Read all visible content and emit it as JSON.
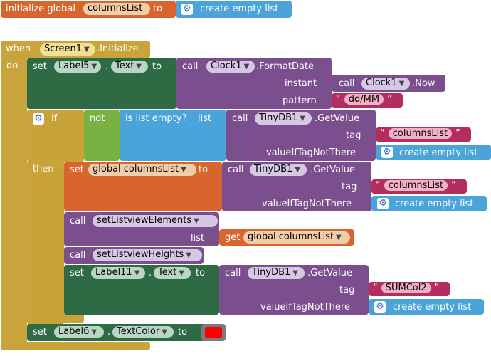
{
  "init_global": {
    "keyword": "initialize global",
    "var_name": "columnsList",
    "to": "to",
    "value_block": "create empty list"
  },
  "event": {
    "when": "when",
    "component": "Screen1",
    "event_name": ".Initialize",
    "do": "do"
  },
  "set_label5": {
    "set": "set",
    "component": "Label5",
    "dot": ".",
    "property": "Text",
    "to": "to",
    "call": "call",
    "clock_component": "Clock1",
    "method": ".FormatDate",
    "instant_label": "instant",
    "instant_call": "call",
    "instant_component": "Clock1",
    "instant_method": ".Now",
    "pattern_label": "pattern",
    "pattern_value": "dd/MM"
  },
  "if_block": {
    "if": "if",
    "not": "not",
    "is_list_empty": "is list empty?",
    "list_label": "list",
    "call": "call",
    "db_component": "TinyDB1",
    "method": ".GetValue",
    "tag_label": "tag",
    "tag_value": "columnsList",
    "default_label": "valueIfTagNotThere",
    "default_value": "create empty list",
    "then": "then"
  },
  "set_global": {
    "set": "set",
    "var_name": "global columnsList",
    "to": "to",
    "call": "call",
    "db_component": "TinyDB1",
    "method": ".GetValue",
    "tag_label": "tag",
    "tag_value": "columnsList",
    "default_label": "valueIfTagNotThere",
    "default_value": "create empty list"
  },
  "call_set_elements": {
    "call": "call",
    "procedure": "setListviewElements",
    "list_label": "list",
    "get": "get",
    "get_var": "global columnsList"
  },
  "call_set_heights": {
    "call": "call",
    "procedure": "setListviewHeights"
  },
  "set_label11": {
    "set": "set",
    "component": "Label11",
    "dot": ".",
    "property": "Text",
    "to": "to",
    "call": "call",
    "db_component": "TinyDB1",
    "method": ".GetValue",
    "tag_label": "tag",
    "tag_value": "SUMCol2",
    "default_label": "valueIfTagNotThere",
    "default_value": "create empty list"
  },
  "set_label6": {
    "set": "set",
    "component": "Label6",
    "dot": ".",
    "property": "TextColor",
    "to": "to",
    "color_value": "#ff0000"
  },
  "colors": {
    "event_gold": "#c9a33b",
    "component_green": "#2e6b45",
    "method_purple": "#7b4f8e",
    "list_blue": "#4aa3d9",
    "text_magenta": "#b32d5e",
    "variable_orange": "#d9652e",
    "logic_green": "#77b242",
    "control_gold": "#c8a33a"
  }
}
